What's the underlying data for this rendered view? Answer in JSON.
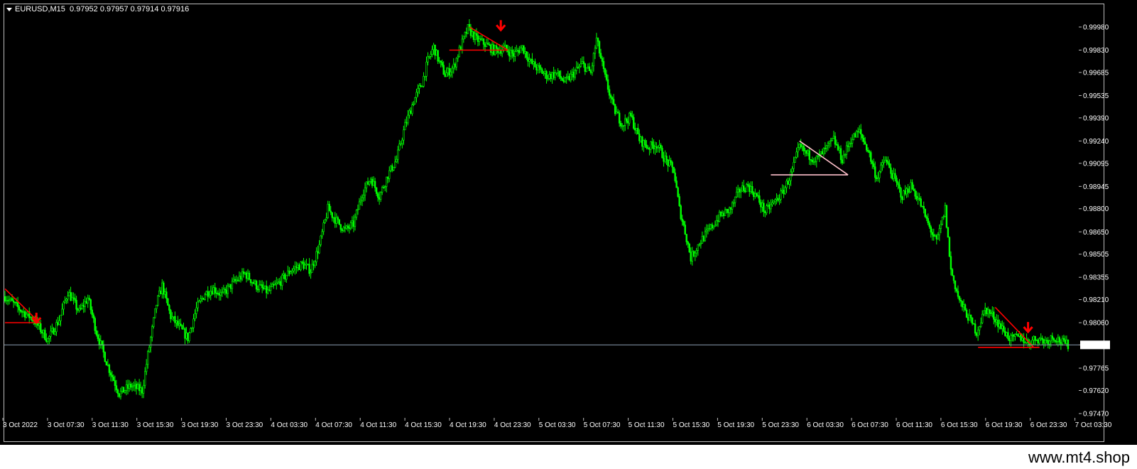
{
  "header": {
    "symbol": "EURUSD,M15",
    "ohlc": "0.97952 0.97957 0.97914 0.97916"
  },
  "watermark": "www.mt4.shop",
  "colors": {
    "background": "#000000",
    "candle": "#00ff00",
    "grid_frame": "#bdbdbd",
    "bid_line": "#8a9bb0",
    "pattern_red": "#ff0000",
    "pattern_pink": "#ffc0cb",
    "price_label_bg": "#ffffff"
  },
  "chart_data": {
    "type": "candlestick",
    "y_axis": {
      "ticks": [
        "0.99980",
        "0.99830",
        "0.99685",
        "0.99535",
        "0.99390",
        "0.99240",
        "0.99095",
        "0.98945",
        "0.98800",
        "0.98650",
        "0.98505",
        "0.98355",
        "0.98210",
        "0.98060",
        "0.97916",
        "0.97765",
        "0.97620",
        "0.97470"
      ],
      "range": [
        0.9747,
        1.0002
      ]
    },
    "x_axis": {
      "ticks": [
        "3 Oct 2022",
        "3 Oct 07:30",
        "3 Oct 11:30",
        "3 Oct 15:30",
        "3 Oct 19:30",
        "3 Oct 23:30",
        "4 Oct 03:30",
        "4 Oct 07:30",
        "4 Oct 11:30",
        "4 Oct 15:30",
        "4 Oct 19:30",
        "4 Oct 23:30",
        "5 Oct 03:30",
        "5 Oct 07:30",
        "5 Oct 11:30",
        "5 Oct 15:30",
        "5 Oct 19:30",
        "5 Oct 23:30",
        "6 Oct 03:30",
        "6 Oct 07:30",
        "6 Oct 11:30",
        "6 Oct 15:30",
        "6 Oct 19:30",
        "6 Oct 23:30",
        "7 Oct 03:30"
      ]
    },
    "current_price": "0.97916",
    "close_path_anchors": [
      [
        0,
        0.9823
      ],
      [
        10,
        0.9815
      ],
      [
        20,
        0.9808
      ],
      [
        30,
        0.9795
      ],
      [
        38,
        0.9808
      ],
      [
        44,
        0.9826
      ],
      [
        52,
        0.9813
      ],
      [
        58,
        0.9822
      ],
      [
        64,
        0.98
      ],
      [
        72,
        0.9778
      ],
      [
        80,
        0.976
      ],
      [
        88,
        0.9765
      ],
      [
        96,
        0.9762
      ],
      [
        100,
        0.9785
      ],
      [
        106,
        0.9818
      ],
      [
        110,
        0.983
      ],
      [
        116,
        0.981
      ],
      [
        122,
        0.9803
      ],
      [
        128,
        0.9796
      ],
      [
        134,
        0.9815
      ],
      [
        140,
        0.9825
      ],
      [
        146,
        0.9828
      ],
      [
        152,
        0.9824
      ],
      [
        160,
        0.9832
      ],
      [
        168,
        0.9838
      ],
      [
        176,
        0.983
      ],
      [
        184,
        0.9826
      ],
      [
        192,
        0.9832
      ],
      [
        200,
        0.984
      ],
      [
        208,
        0.9844
      ],
      [
        214,
        0.984
      ],
      [
        220,
        0.9856
      ],
      [
        226,
        0.988
      ],
      [
        232,
        0.9872
      ],
      [
        238,
        0.9866
      ],
      [
        244,
        0.987
      ],
      [
        250,
        0.989
      ],
      [
        256,
        0.99
      ],
      [
        262,
        0.9888
      ],
      [
        268,
        0.9902
      ],
      [
        274,
        0.9912
      ],
      [
        280,
        0.9934
      ],
      [
        286,
        0.995
      ],
      [
        292,
        0.9962
      ],
      [
        296,
        0.9976
      ],
      [
        300,
        0.9985
      ],
      [
        304,
        0.9975
      ],
      [
        308,
        0.9967
      ],
      [
        314,
        0.9972
      ],
      [
        318,
        0.9983
      ],
      [
        324,
        0.9997
      ],
      [
        330,
        0.999
      ],
      [
        336,
        0.9987
      ],
      [
        342,
        0.9983
      ],
      [
        350,
        0.9984
      ],
      [
        356,
        0.998
      ],
      [
        362,
        0.9985
      ],
      [
        368,
        0.9975
      ],
      [
        374,
        0.997
      ],
      [
        380,
        0.9966
      ],
      [
        386,
        0.9968
      ],
      [
        392,
        0.9962
      ],
      [
        398,
        0.9968
      ],
      [
        404,
        0.9974
      ],
      [
        410,
        0.9968
      ],
      [
        414,
        0.999
      ],
      [
        420,
        0.9965
      ],
      [
        426,
        0.9945
      ],
      [
        432,
        0.9935
      ],
      [
        438,
        0.994
      ],
      [
        444,
        0.9925
      ],
      [
        450,
        0.992
      ],
      [
        456,
        0.9922
      ],
      [
        462,
        0.9912
      ],
      [
        468,
        0.9905
      ],
      [
        472,
        0.988
      ],
      [
        476,
        0.9865
      ],
      [
        480,
        0.9848
      ],
      [
        486,
        0.9858
      ],
      [
        492,
        0.9865
      ],
      [
        500,
        0.9875
      ],
      [
        508,
        0.988
      ],
      [
        514,
        0.9892
      ],
      [
        520,
        0.9895
      ],
      [
        526,
        0.9888
      ],
      [
        532,
        0.9878
      ],
      [
        538,
        0.9884
      ],
      [
        544,
        0.989
      ],
      [
        550,
        0.9902
      ],
      [
        556,
        0.992
      ],
      [
        562,
        0.9915
      ],
      [
        568,
        0.9912
      ],
      [
        574,
        0.9918
      ],
      [
        580,
        0.9925
      ],
      [
        586,
        0.9912
      ],
      [
        592,
        0.9925
      ],
      [
        598,
        0.993
      ],
      [
        604,
        0.9918
      ],
      [
        610,
        0.99
      ],
      [
        616,
        0.9912
      ],
      [
        622,
        0.99
      ],
      [
        628,
        0.9888
      ],
      [
        634,
        0.9895
      ],
      [
        640,
        0.9885
      ],
      [
        646,
        0.987
      ],
      [
        652,
        0.9858
      ],
      [
        658,
        0.988
      ],
      [
        662,
        0.984
      ],
      [
        668,
        0.982
      ],
      [
        674,
        0.981
      ],
      [
        680,
        0.98
      ],
      [
        686,
        0.9815
      ],
      [
        692,
        0.981
      ],
      [
        698,
        0.9802
      ],
      [
        704,
        0.9795
      ],
      [
        710,
        0.9797
      ],
      [
        716,
        0.9793
      ],
      [
        722,
        0.9796
      ],
      [
        728,
        0.9794
      ],
      [
        734,
        0.9797
      ],
      [
        740,
        0.9793
      ],
      [
        744,
        0.97916
      ]
    ],
    "patterns": [
      {
        "color": "red",
        "lines": [
          [
            0.9828,
            0,
            22,
            0.9808
          ],
          [
            0.9806,
            0,
            25,
            0.9806
          ]
        ],
        "arrow": [
          0.9806,
          22
        ]
      },
      {
        "color": "red",
        "lines": [
          [
            0.9998,
            325,
            352,
            0.9983
          ],
          [
            0.9983,
            311,
            352,
            0.9983
          ]
        ],
        "arrow": [
          0.9996,
          347
        ]
      },
      {
        "color": "pink",
        "lines": [
          [
            0.9924,
            556,
            590,
            0.9902
          ],
          [
            0.9902,
            536,
            590,
            0.9902
          ]
        ],
        "arrow": null
      },
      {
        "color": "red",
        "lines": [
          [
            0.9816,
            693,
            720,
            0.979
          ],
          [
            0.979,
            681,
            724,
            0.979
          ]
        ],
        "arrow": [
          0.98,
          716
        ]
      }
    ]
  }
}
